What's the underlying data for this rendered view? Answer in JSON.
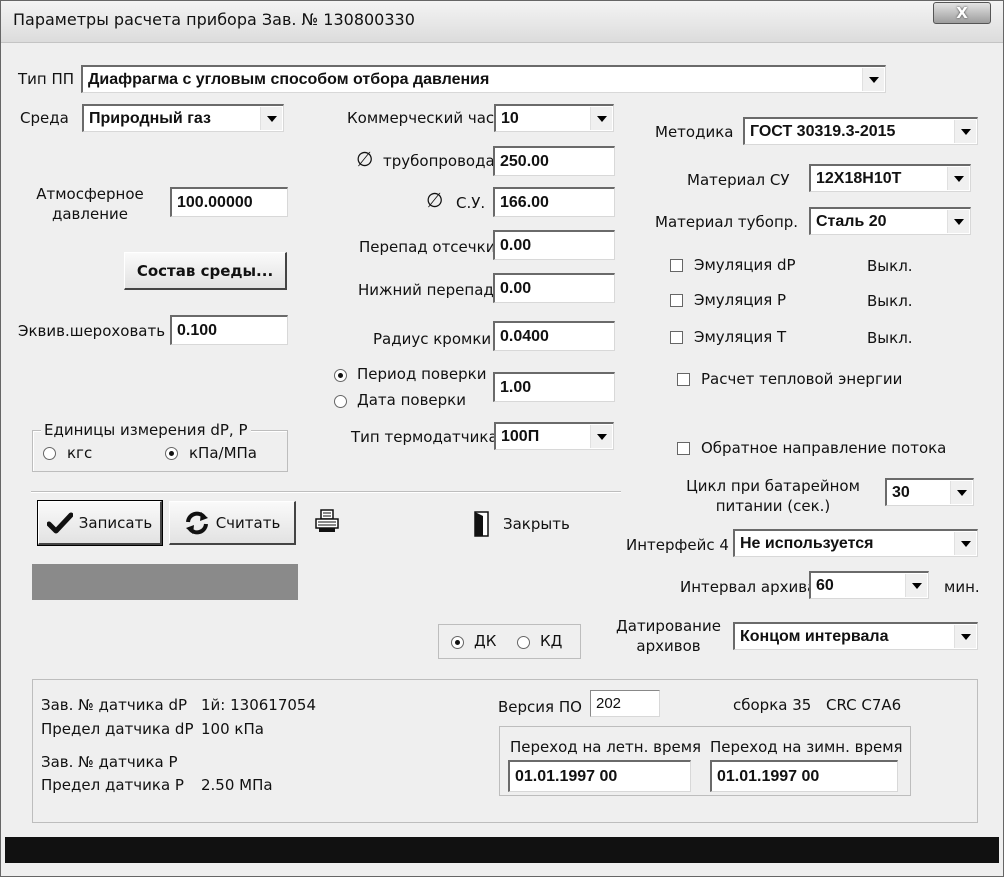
{
  "window": {
    "title": "Параметры расчета прибора  Зав. № 130800330",
    "close": "X"
  },
  "pp_type": {
    "label": "Тип ПП",
    "value": "Диафрагма с угловым способом отбора давления"
  },
  "medium": {
    "label": "Среда",
    "value": "Природный газ"
  },
  "atm_pressure": {
    "label_line1": "Атмосферное",
    "label_line2": "давление",
    "value": "100.00000"
  },
  "composition_button": "Состав среды...",
  "roughness": {
    "label": "Эквив.шероховать",
    "value": "0.100"
  },
  "units": {
    "legend": "Единицы измерения dP, P",
    "option1": "кгс",
    "option2": "кПа/МПа",
    "selected": "кПа/МПа"
  },
  "commercial_hour": {
    "label": "Коммерческий час",
    "value": "10"
  },
  "pipe_diameter": {
    "symbol": "∅",
    "label": "трубопровода",
    "value": "250.00"
  },
  "su_diameter": {
    "symbol": "∅",
    "label": "С.У.",
    "value": "166.00"
  },
  "cutoff_drop": {
    "label": "Перепад отсечки",
    "value": "0.00"
  },
  "low_drop": {
    "label": "Нижний перепад",
    "value": "0.00"
  },
  "edge_radius": {
    "label": "Радиус кромки",
    "value": "0.0400"
  },
  "verification": {
    "option1": "Период поверки",
    "option2": "Дата поверки",
    "selected": "Период поверки",
    "value": "1.00"
  },
  "thermo_sensor": {
    "label": "Тип термодатчика",
    "value": "100П"
  },
  "methodology": {
    "label": "Методика",
    "value": "ГОСТ 30319.3-2015"
  },
  "su_material": {
    "label": "Материал СУ",
    "value": "12Х18Н10Т"
  },
  "pipe_material": {
    "label": "Материал тубопр.",
    "value": "Сталь 20"
  },
  "emulation": [
    {
      "label": "Эмуляция dP",
      "state": "Выкл."
    },
    {
      "label": "Эмуляция P",
      "state": "Выкл."
    },
    {
      "label": "Эмуляция T",
      "state": "Выкл."
    }
  ],
  "heat_energy": "Расчет тепловой энергии",
  "reverse_flow": "Обратное направление потока",
  "battery_cycle": {
    "label_line1": "Цикл при батарейном",
    "label_line2": "питании (сек.)",
    "value": "30"
  },
  "interface4": {
    "label": "Интерфейс 4",
    "value": "Не используется"
  },
  "archive_interval": {
    "label": "Интервал архива",
    "value": "60",
    "unit": "мин."
  },
  "archive_dating": {
    "label_line1": "Датирование",
    "label_line2": "архивов",
    "value": "Концом интервала"
  },
  "toolbar": {
    "write": "Записать",
    "read": "Считать",
    "close": "Закрыть"
  },
  "dk_kd": {
    "option1": "ДК",
    "option2": "КД",
    "selected": "ДК"
  },
  "sensors": {
    "dp_serial_label": "Зав. № датчика dP",
    "dp_serial_value": "1й:  130617054",
    "dp_limit_label": "Предел датчика dP",
    "dp_limit_value": "100 кПа",
    "p_serial_label": "Зав. № датчика P",
    "p_limit_label": "Предел датчика P",
    "p_limit_value": "2.50 МПа"
  },
  "firmware": {
    "version_label": "Версия ПО",
    "version_value": "202",
    "build": "сборка 35",
    "crc": "CRC C7A6"
  },
  "dst": {
    "summer_label": "Переход на летн. время",
    "summer_value": "01.01.1997 00",
    "winter_label": "Переход на зимн. время",
    "winter_value": "01.01.1997 00"
  }
}
